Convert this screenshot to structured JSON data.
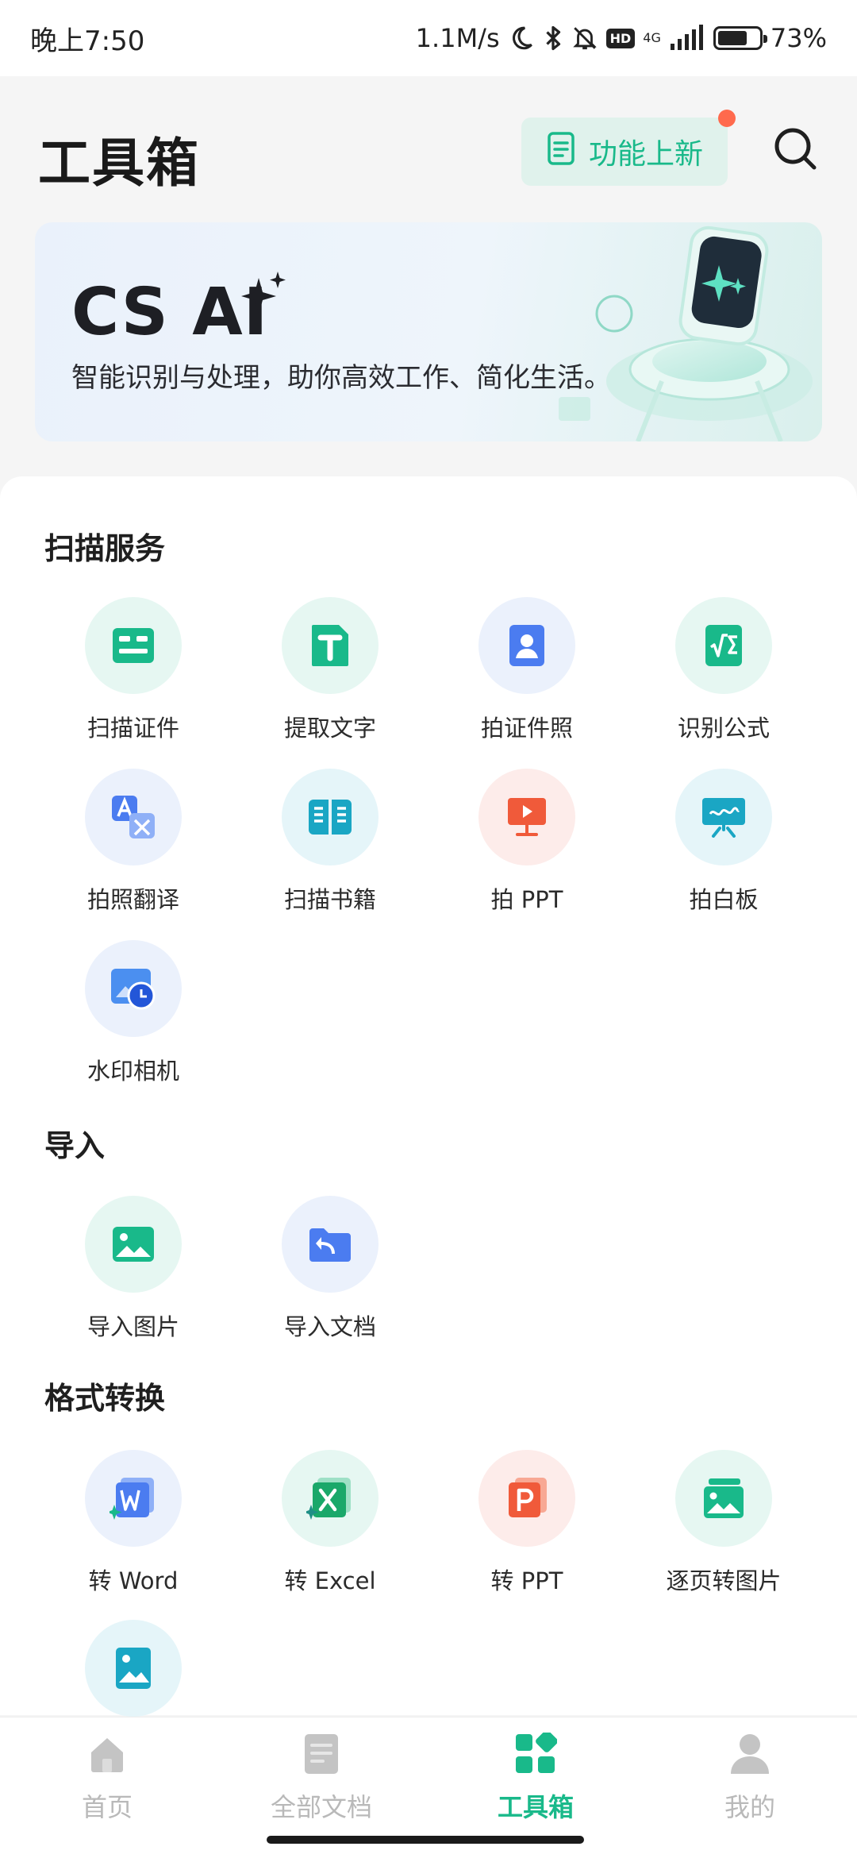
{
  "status_bar": {
    "time": "晚上7:50",
    "net_speed": "1.1M/s",
    "hd_badge": "HD",
    "network_type": "4G",
    "battery_text": "73%",
    "battery_level": 0.73
  },
  "header": {
    "title": "工具箱",
    "new_features_label": "功能上新"
  },
  "banner": {
    "title": "CS AI",
    "subtitle": "智能识别与处理，助你高效工作、简化生活。"
  },
  "sections": {
    "scan": {
      "title": "扫描服务",
      "items": [
        {
          "label": "扫描证件",
          "icon": "id-card-icon"
        },
        {
          "label": "提取文字",
          "icon": "text-extract-icon"
        },
        {
          "label": "拍证件照",
          "icon": "id-photo-icon"
        },
        {
          "label": "识别公式",
          "icon": "formula-icon"
        },
        {
          "label": "拍照翻译",
          "icon": "translate-icon"
        },
        {
          "label": "扫描书籍",
          "icon": "book-icon"
        },
        {
          "label": "拍 PPT",
          "icon": "presentation-icon"
        },
        {
          "label": "拍白板",
          "icon": "whiteboard-icon"
        },
        {
          "label": "水印相机",
          "icon": "watermark-camera-icon"
        }
      ]
    },
    "import": {
      "title": "导入",
      "items": [
        {
          "label": "导入图片",
          "icon": "image-icon"
        },
        {
          "label": "导入文档",
          "icon": "folder-import-icon"
        }
      ]
    },
    "convert": {
      "title": "格式转换",
      "items": [
        {
          "label": "转 Word",
          "icon": "word-icon"
        },
        {
          "label": "转 Excel",
          "icon": "excel-icon"
        },
        {
          "label": "转 PPT",
          "icon": "ppt-icon"
        },
        {
          "label": "逐页转图片",
          "icon": "pages-to-image-icon"
        },
        {
          "label": "",
          "icon": "long-image-icon"
        }
      ]
    }
  },
  "bottom_nav": {
    "items": [
      {
        "label": "首页",
        "icon": "home-icon"
      },
      {
        "label": "全部文档",
        "icon": "documents-icon"
      },
      {
        "label": "工具箱",
        "icon": "toolbox-icon",
        "active": true
      },
      {
        "label": "我的",
        "icon": "profile-icon"
      }
    ]
  },
  "colors": {
    "accent": "#19b98a",
    "badge": "#ff6a4d",
    "inactive": "#b9b9b9"
  }
}
